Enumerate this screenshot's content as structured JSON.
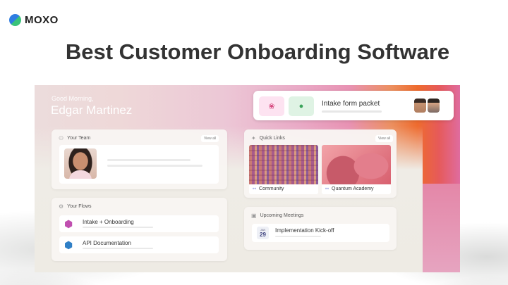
{
  "brand": {
    "logo_text": "MOXO",
    "logo_icon": "moxo-logo-icon"
  },
  "headline": "Best Customer Onboarding Software",
  "app": {
    "greeting": "Good Morning,",
    "user_name": "Edgar Martinez",
    "intake": {
      "title": "Intake form packet",
      "icons": [
        "award-icon",
        "check-circle-icon"
      ]
    },
    "team": {
      "title": "Your Team",
      "view_all": "View all"
    },
    "flows": {
      "title": "Your Flows",
      "items": [
        {
          "label": "Intake + Onboarding",
          "icon": "hexagon-icon",
          "color": "#c04fb0"
        },
        {
          "label": "API Documentation",
          "icon": "hexagon-icon",
          "color": "#2f7fc6"
        }
      ]
    },
    "quick_links": {
      "title": "Quick Links",
      "view_all": "View all",
      "items": [
        {
          "label": "Community",
          "icon": "link-icon"
        },
        {
          "label": "Quantum Academy",
          "icon": "link-icon"
        }
      ]
    },
    "meetings": {
      "title": "Upcoming Meetings",
      "items": [
        {
          "month": "JAN",
          "day": "29",
          "label": "Implementation Kick-off"
        }
      ]
    }
  },
  "colors": {
    "accent_orange": "#ee6b2e",
    "accent_pink": "#e892b3",
    "logo_blue": "#2f7de1",
    "logo_green": "#39c27a"
  }
}
